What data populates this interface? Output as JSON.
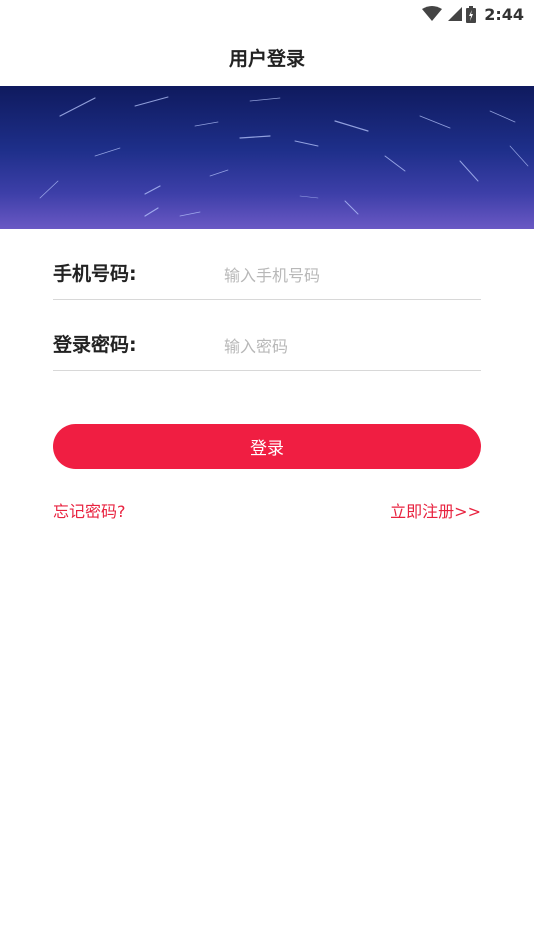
{
  "status_bar": {
    "time": "2:44"
  },
  "header": {
    "title": "用户登录"
  },
  "form": {
    "phone_label": "手机号码:",
    "phone_placeholder": "输入手机号码",
    "password_label": "登录密码:",
    "password_placeholder": "输入密码"
  },
  "actions": {
    "login_label": "登录",
    "forgot_label": "忘记密码?",
    "register_label": "立即注册>>"
  },
  "colors": {
    "accent": "#f01e42",
    "link": "#e8223f",
    "banner_top": "#0f1a5e",
    "banner_bottom": "#6a58c4"
  }
}
